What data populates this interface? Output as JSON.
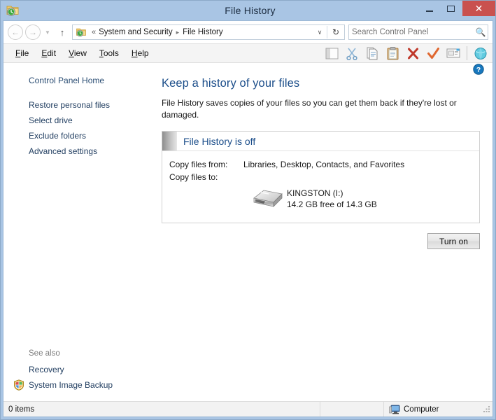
{
  "window": {
    "title": "File History",
    "icon": "file-history-icon",
    "buttons": {
      "minimize": "Minimize",
      "maximize": "Maximize",
      "close": "Close"
    }
  },
  "navbar": {
    "back": "Back",
    "forward": "Forward",
    "recent_dropdown": "Recent locations",
    "up": "Up one level",
    "breadcrumb_separator": "«",
    "breadcrumbs": [
      "System and Security",
      "File History"
    ],
    "crumb_arrow": "▸",
    "address_dropdown": "∨",
    "refresh": "↻",
    "search": {
      "value": "",
      "placeholder": "Search Control Panel"
    }
  },
  "menubar": {
    "items": [
      {
        "accel": "F",
        "rest": "ile"
      },
      {
        "accel": "E",
        "rest": "dit"
      },
      {
        "accel": "V",
        "rest": "iew"
      },
      {
        "accel": "T",
        "rest": "ools"
      },
      {
        "accel": "H",
        "rest": "elp"
      }
    ]
  },
  "toolbar": {
    "icons": [
      "layout-panel-icon",
      "scissors-cut-icon",
      "copy-icon",
      "paste-clipboard-icon",
      "delete-x-icon",
      "checkmark-icon",
      "email-icon",
      "globe-icon"
    ]
  },
  "sidebar": {
    "home": "Control Panel Home",
    "items": [
      "Restore personal files",
      "Select drive",
      "Exclude folders",
      "Advanced settings"
    ],
    "see_also": {
      "label": "See also",
      "items": [
        {
          "text": "Recovery",
          "icon": null
        },
        {
          "text": "System Image Backup",
          "icon": "windows-shield-icon"
        }
      ]
    }
  },
  "content": {
    "help": "?",
    "heading": "Keep a history of your files",
    "description": "File History saves copies of your files so you can get them back if they're lost or damaged.",
    "status_panel": {
      "state_title": "File History is off",
      "rows": [
        {
          "label": "Copy files from:",
          "value": "Libraries, Desktop, Contacts, and Favorites"
        },
        {
          "label": "Copy files to:",
          "value": ""
        }
      ],
      "drive": {
        "icon": "usb-flash-drive-icon",
        "name": "KINGSTON (I:)",
        "capacity": "14.2 GB free of 14.3 GB"
      }
    },
    "primary_button": "Turn on"
  },
  "statusbar": {
    "items_count": "0 items",
    "location_icon": "computer-icon",
    "location": "Computer"
  },
  "colors": {
    "frame": "#a9c5e4",
    "close_button": "#c9514f",
    "heading_blue": "#1c4e8a",
    "link_blue": "#1f3c5f",
    "help_blue": "#1878be"
  }
}
